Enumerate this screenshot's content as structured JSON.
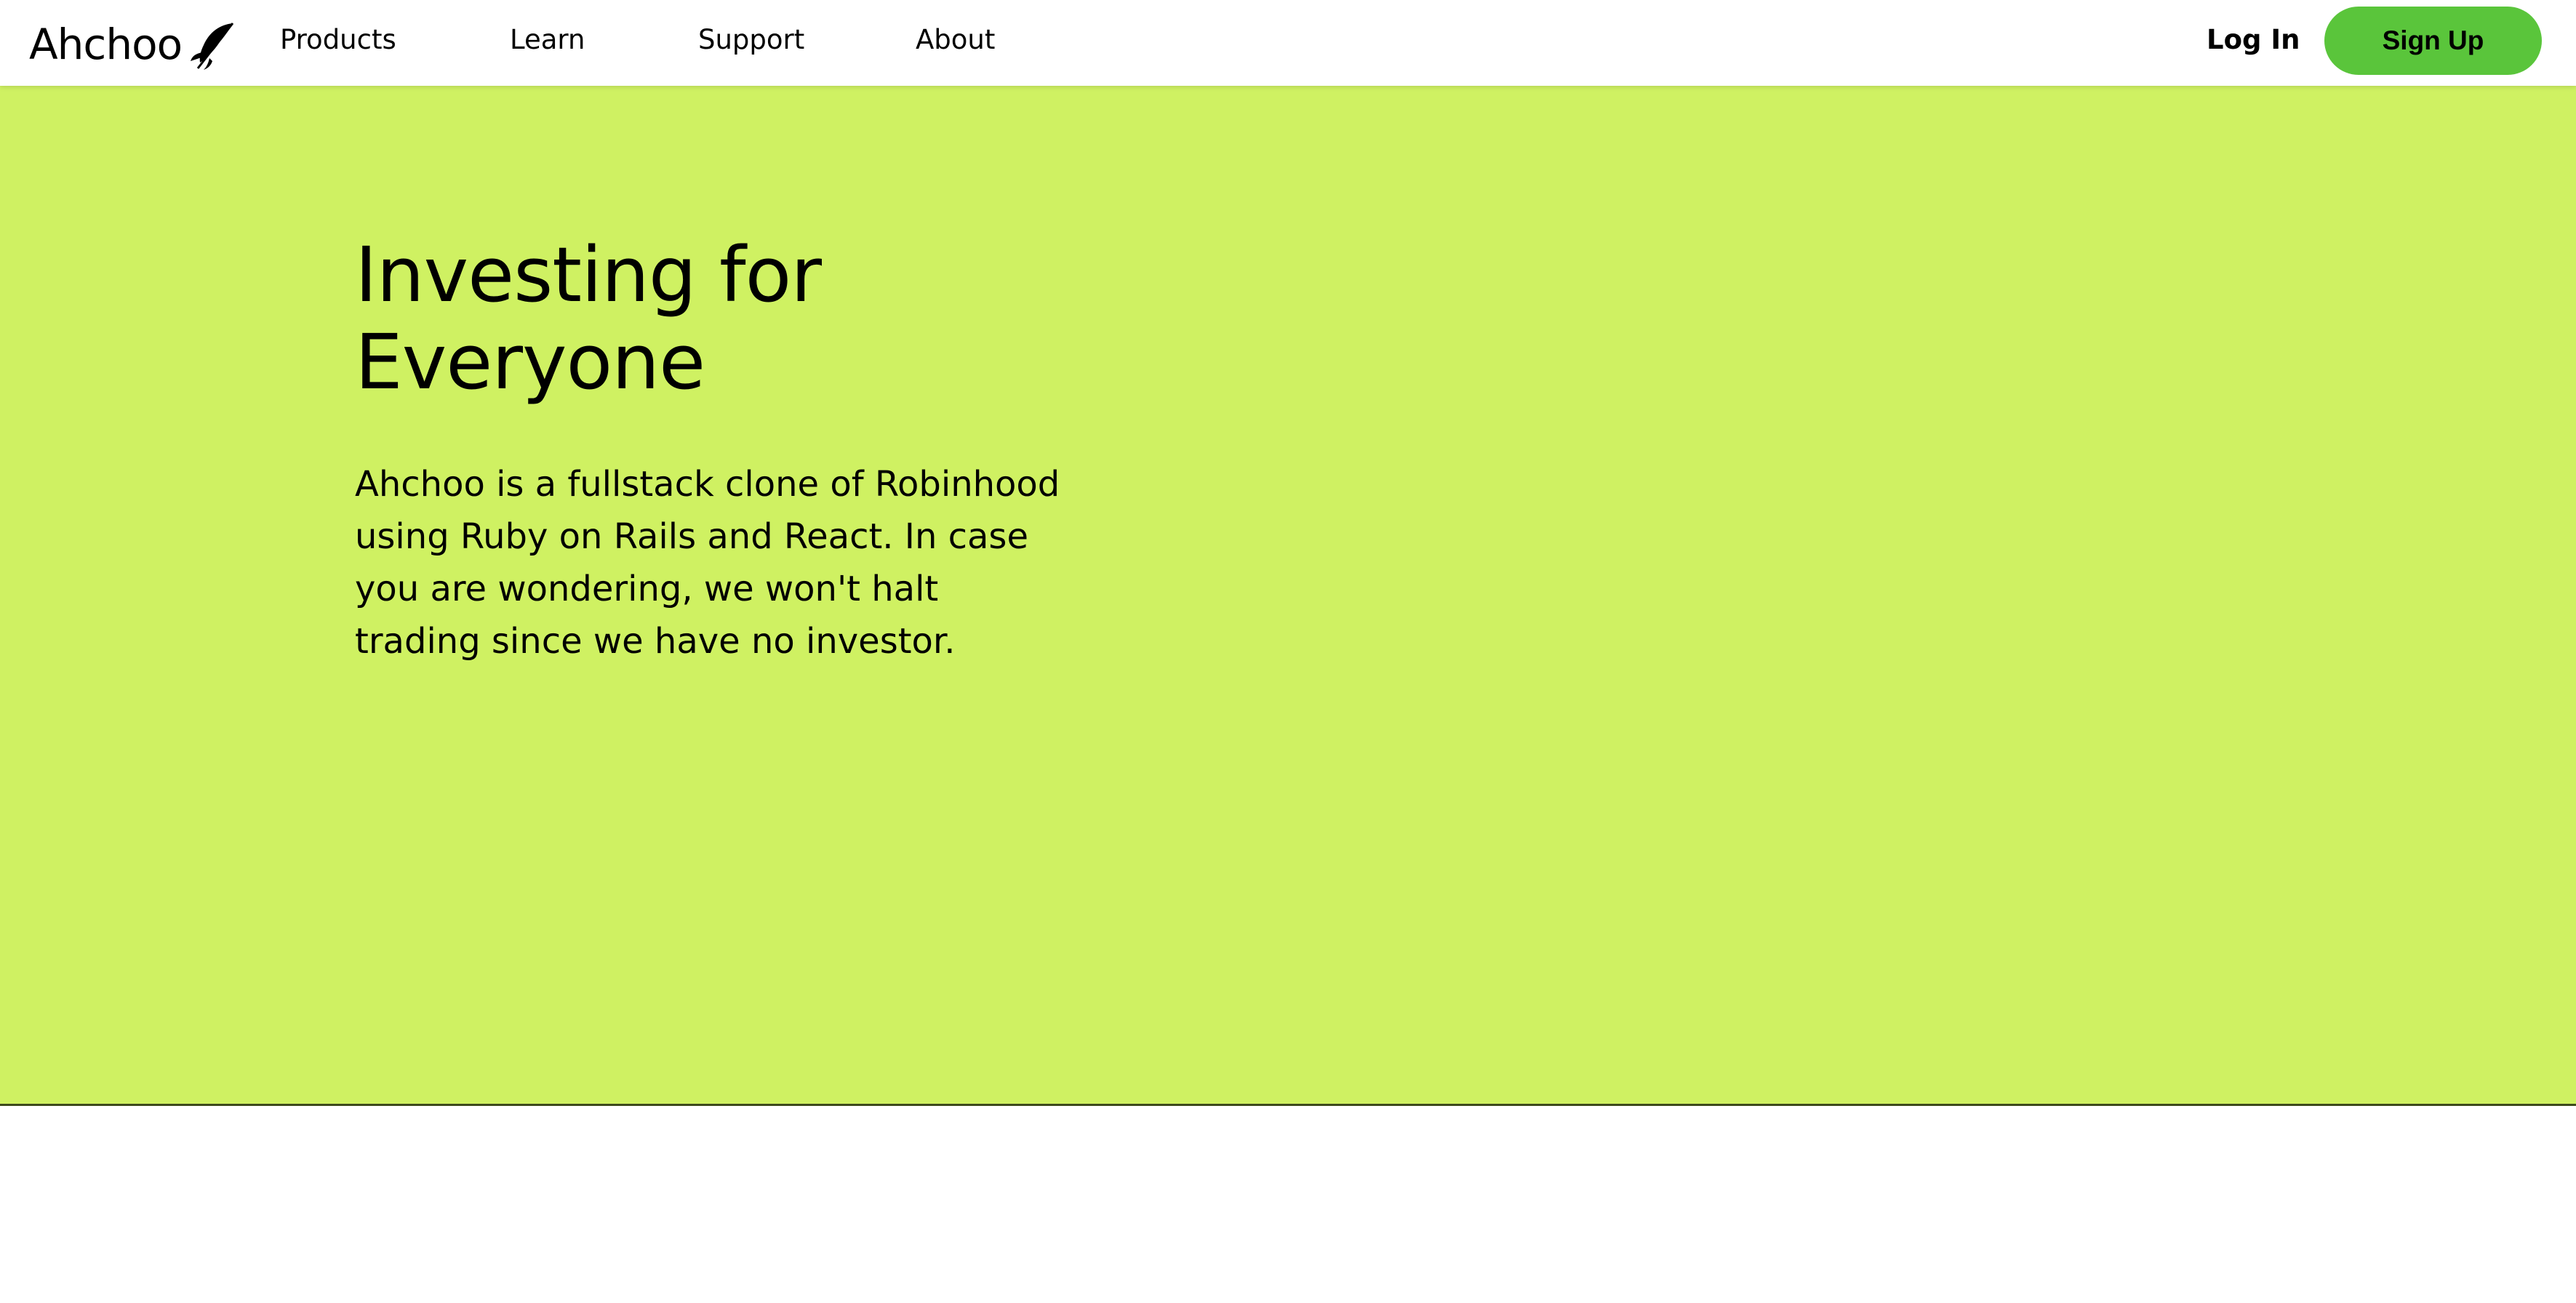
{
  "brand": {
    "name": "Ahchoo",
    "icon": "feather-rocket-icon"
  },
  "nav": {
    "items": [
      {
        "label": "Products"
      },
      {
        "label": "Learn"
      },
      {
        "label": "Support"
      },
      {
        "label": "About"
      }
    ],
    "login_label": "Log In",
    "signup_label": "Sign Up"
  },
  "hero": {
    "title_line1": "Investing for",
    "title_line2": "Everyone",
    "description": "Ahchoo is a fullstack clone of Robinhood using Ruby on Rails and React. In case you are wondering, we won't halt trading since we have no investor."
  },
  "colors": {
    "hero_background": "#cff162",
    "signup_button": "#5ac53b",
    "text": "#000000"
  }
}
